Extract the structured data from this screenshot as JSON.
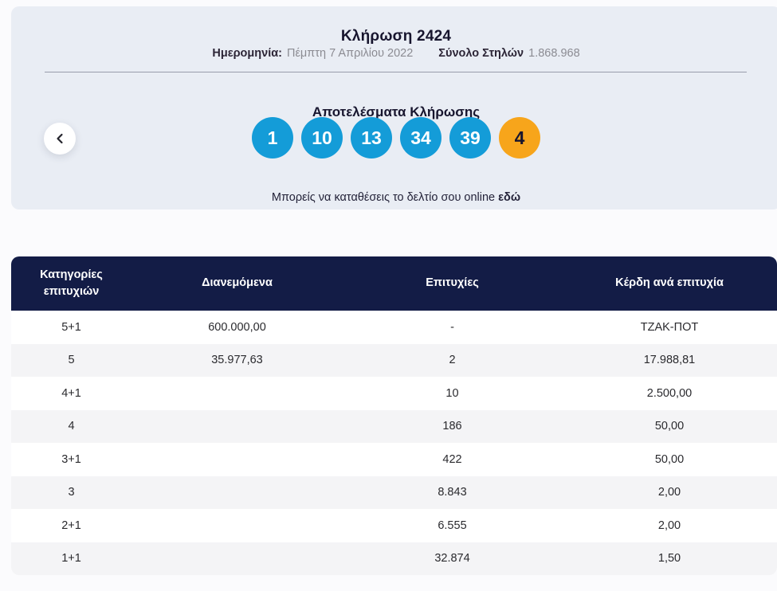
{
  "colors": {
    "panel_bg": "#e9edf4",
    "ball_blue": "#149cd8",
    "ball_orange": "#f7a51b",
    "table_header_bg": "#131c46",
    "row_alt_bg": "#f4f4f6",
    "label_dark": "#2c2536",
    "value_gray": "#8b8b92",
    "text_dark": "#17152e"
  },
  "draw": {
    "title": "Κλήρωση 2424",
    "date_label": "Ημερομηνία:",
    "date_value": "Πέμπτη 7 Απριλίου 2022",
    "columns_label": "Σύνολο Στηλών",
    "columns_value": "1.868.968",
    "results_title": "Αποτελέσματα Κλήρωσης",
    "balls": [
      {
        "number": "1",
        "type": "main"
      },
      {
        "number": "10",
        "type": "main"
      },
      {
        "number": "13",
        "type": "main"
      },
      {
        "number": "34",
        "type": "main"
      },
      {
        "number": "39",
        "type": "main"
      },
      {
        "number": "4",
        "type": "bonus"
      }
    ],
    "deposit_text": "Μπορείς να καταθέσεις το δελτίο σου online",
    "deposit_link": "εδώ"
  },
  "nav": {
    "prev_label": "previous draw"
  },
  "table": {
    "headers": [
      "Κατηγορίες επιτυχιών",
      "Διανεμόμενα",
      "Επιτυχίες",
      "Κέρδη ανά επιτυχία"
    ],
    "rows": [
      {
        "category": "5+1",
        "distributed": "600.000,00",
        "winners": "-",
        "prize": "ΤΖΑΚ-ΠΟΤ"
      },
      {
        "category": "5",
        "distributed": "35.977,63",
        "winners": "2",
        "prize": "17.988,81"
      },
      {
        "category": "4+1",
        "distributed": "",
        "winners": "10",
        "prize": "2.500,00"
      },
      {
        "category": "4",
        "distributed": "",
        "winners": "186",
        "prize": "50,00"
      },
      {
        "category": "3+1",
        "distributed": "",
        "winners": "422",
        "prize": "50,00"
      },
      {
        "category": "3",
        "distributed": "",
        "winners": "8.843",
        "prize": "2,00"
      },
      {
        "category": "2+1",
        "distributed": "",
        "winners": "6.555",
        "prize": "2,00"
      },
      {
        "category": "1+1",
        "distributed": "",
        "winners": "32.874",
        "prize": "1,50"
      }
    ]
  }
}
